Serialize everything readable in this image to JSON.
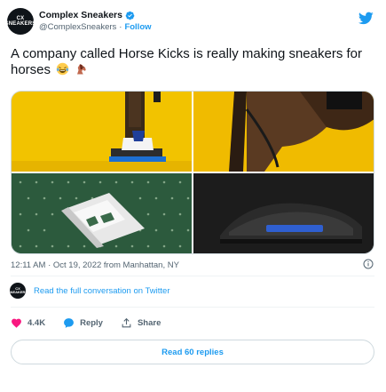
{
  "account": {
    "avatar_text_line1": "CX",
    "avatar_text_line2": "SNEAKERS",
    "display_name": "Complex Sneakers",
    "handle": "@ComplexSneakers",
    "separator": "·",
    "follow_label": "Follow"
  },
  "tweet": {
    "text": "A company called Horse Kicks is really making sneakers for horses",
    "emojis": [
      "laughing-crying-face-icon",
      "horse-icon"
    ],
    "timestamp": "12:11 AM · Oct 19, 2022 from Manhattan, NY"
  },
  "footer": {
    "conversation_link": "Read the full conversation on Twitter",
    "like_count": "4.4K",
    "reply_label": "Reply",
    "share_label": "Share",
    "read_replies_label": "Read 60 replies"
  },
  "colors": {
    "accent": "#1d9bf0",
    "like": "#f91880",
    "muted": "#536471",
    "text": "#0f1419"
  }
}
